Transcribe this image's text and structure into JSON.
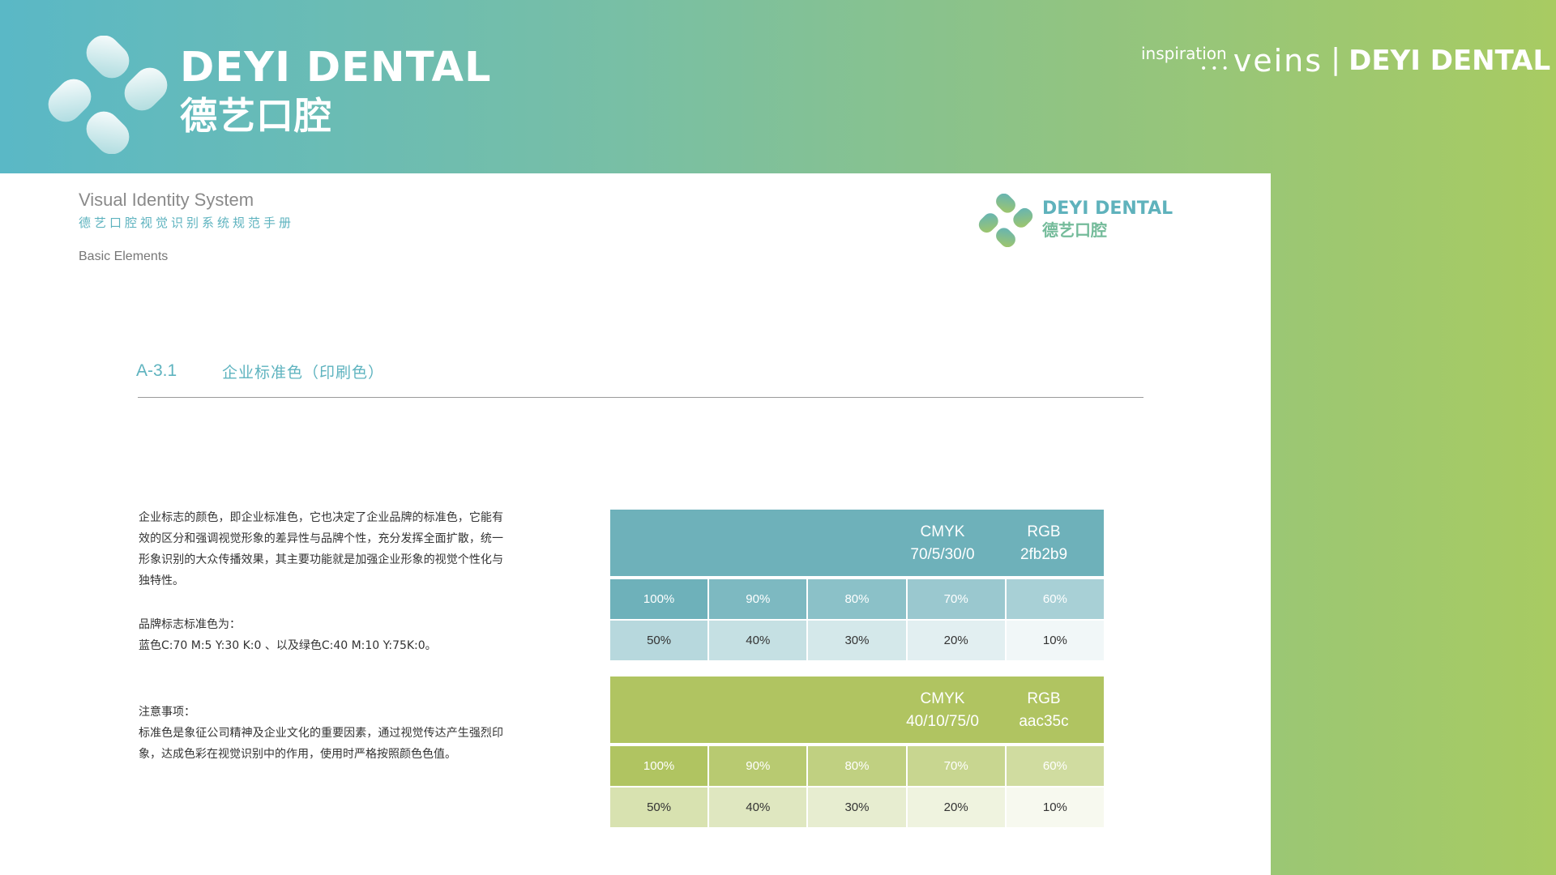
{
  "header": {
    "brand_en": "DEYI DENTAL",
    "brand_cn": "德艺口腔",
    "tagline_inspiration": "inspiration",
    "tagline_veins": "veins",
    "tagline_separator": "|",
    "tagline_brand": "DEYI DENTAL"
  },
  "page": {
    "vis_en": "Visual Identity System",
    "vis_cn": "德艺口腔视觉识别系统规范手册",
    "basic": "Basic Elements",
    "small_logo_en": "DEYI DENTAL",
    "small_logo_cn": "德艺口腔"
  },
  "section": {
    "number": "A-3.1",
    "title": "企业标准色（印刷色）"
  },
  "text": {
    "p1": "企业标志的颜色，即企业标准色，它也决定了企业品牌的标准色，它能有效的区分和强调视觉形象的差异性与品牌个性，充分发挥全面扩散，统一形象识别的大众传播效果，其主要功能就是加强企业形象的视觉个性化与独特性。",
    "p2_title": "品牌标志标准色为：",
    "p2_body": "蓝色C:70  M:5 Y:30 K:0 、以及绿色C:40  M:10 Y:75K:0。",
    "p3_title": "注意事项：",
    "p3_body": "标准色是象征公司精神及企业文化的重要因素，通过视觉传达产生强烈印象，达成色彩在视觉识别中的作用，使用时严格按照颜色色值。"
  },
  "swatches": [
    {
      "cmyk_label": "CMYK",
      "cmyk_value": "70/5/30/0",
      "rgb_label": "RGB",
      "rgb_value": "2fb2b9",
      "color": "#6eb1ba",
      "tints": [
        {
          "label": "100%",
          "level": 1.0
        },
        {
          "label": "90%",
          "level": 0.9
        },
        {
          "label": "80%",
          "level": 0.8
        },
        {
          "label": "70%",
          "level": 0.7
        },
        {
          "label": "60%",
          "level": 0.6
        },
        {
          "label": "50%",
          "level": 0.5
        },
        {
          "label": "40%",
          "level": 0.4
        },
        {
          "label": "30%",
          "level": 0.3
        },
        {
          "label": "20%",
          "level": 0.2
        },
        {
          "label": "10%",
          "level": 0.1
        }
      ]
    },
    {
      "cmyk_label": "CMYK",
      "cmyk_value": "40/10/75/0",
      "rgb_label": "RGB",
      "rgb_value": "aac35c",
      "color": "#b0c461",
      "tints": [
        {
          "label": "100%",
          "level": 1.0
        },
        {
          "label": "90%",
          "level": 0.9
        },
        {
          "label": "80%",
          "level": 0.8
        },
        {
          "label": "70%",
          "level": 0.7
        },
        {
          "label": "60%",
          "level": 0.6
        },
        {
          "label": "50%",
          "level": 0.5
        },
        {
          "label": "40%",
          "level": 0.4
        },
        {
          "label": "30%",
          "level": 0.3
        },
        {
          "label": "20%",
          "level": 0.2
        },
        {
          "label": "10%",
          "level": 0.1
        }
      ]
    }
  ]
}
